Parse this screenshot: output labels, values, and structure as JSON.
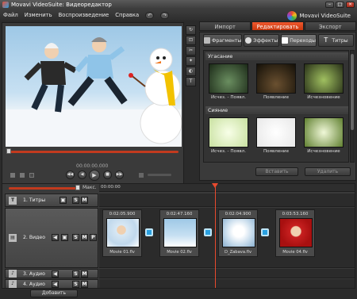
{
  "window": {
    "title": "Movavi VideoSuite: Видеоредактор"
  },
  "menu": [
    "Файл",
    "Изменить",
    "Воспроизведение",
    "Справка"
  ],
  "brand": "Movavi VideoSuite",
  "player": {
    "time": "00:00:00.000",
    "progress": 0.0
  },
  "tools": [
    "rotate",
    "crop",
    "dual",
    "fx",
    "color",
    "text"
  ],
  "main_tabs": [
    {
      "label": "Импорт",
      "active": false
    },
    {
      "label": "Редактировать",
      "active": true
    },
    {
      "label": "Экспорт",
      "active": false
    }
  ],
  "sub_tabs": [
    {
      "label": "Фрагменты",
      "icon": "film-icon",
      "active": false
    },
    {
      "label": "Эффекты",
      "icon": "effects-icon",
      "active": false
    },
    {
      "label": "Переходы",
      "icon": "transitions-icon",
      "active": true
    },
    {
      "label": "Титры",
      "icon": "titles-icon",
      "active": false
    }
  ],
  "groups": [
    {
      "title": "Угасание",
      "items": [
        "Исчез. - Появл.",
        "Появление",
        "Исчезновение"
      ]
    },
    {
      "title": "Сияние",
      "items": [
        "Исчез. - Появл.",
        "Появление",
        "Исчезновение"
      ]
    }
  ],
  "buttons": {
    "insert": "Вставить",
    "remove": "Удалить"
  },
  "timeline": {
    "zoom_label": "Макс.",
    "ruler_time": "00:00:00",
    "tracks": [
      {
        "name": "1. Титры",
        "icon": "T"
      },
      {
        "name": "2. Видео",
        "icon": "V"
      },
      {
        "name": "3. Аудио",
        "icon": "♪"
      },
      {
        "name": "4. Аудио",
        "icon": "♪"
      }
    ],
    "clips": [
      {
        "time": "0:02:05.900",
        "name": "Movie 01.flv"
      },
      {
        "time": "0:02:47.160",
        "name": "Movie 02.flv"
      },
      {
        "time": "0:02:04.900",
        "name": "D_Zabava.flv"
      },
      {
        "time": "0:03:53.160",
        "name": "Movie 04.flv"
      }
    ],
    "add_label": "Добавить"
  }
}
